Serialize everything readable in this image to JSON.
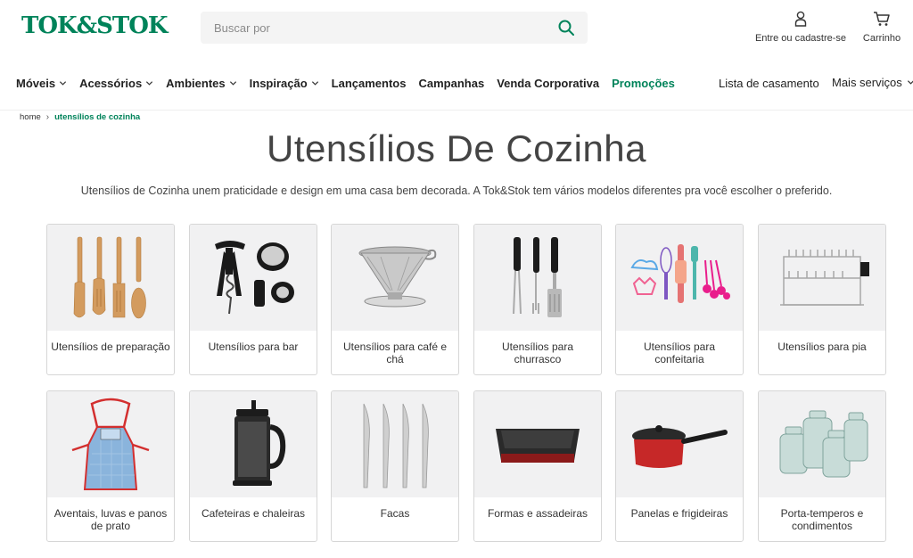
{
  "brand": {
    "logo_text": "TOK&STOK",
    "accent": "#00835a"
  },
  "search": {
    "placeholder": "Buscar por"
  },
  "account": {
    "label": "Entre ou cadastre-se"
  },
  "cart": {
    "label": "Carrinho"
  },
  "nav": {
    "items": [
      {
        "label": "Móveis",
        "has_dropdown": true
      },
      {
        "label": "Acessórios",
        "has_dropdown": true
      },
      {
        "label": "Ambientes",
        "has_dropdown": true
      },
      {
        "label": "Inspiração",
        "has_dropdown": true
      },
      {
        "label": "Lançamentos",
        "has_dropdown": false
      },
      {
        "label": "Campanhas",
        "has_dropdown": false
      },
      {
        "label": "Venda Corporativa",
        "has_dropdown": false
      },
      {
        "label": "Promoções",
        "has_dropdown": false,
        "highlight": "#00835a"
      }
    ],
    "right": {
      "wedding_list": "Lista de casamento",
      "more_services": "Mais serviços"
    }
  },
  "breadcrumb": {
    "home": "home",
    "current": "utensílios de cozinha"
  },
  "page": {
    "title": "Utensílios De Cozinha",
    "intro": "Utensílios de Cozinha unem praticidade e design em uma casa bem decorada. A Tok&Stok tem vários modelos diferentes pra você escolher o preferido."
  },
  "categories": [
    {
      "label": "Utensílios de preparação",
      "icon": "wooden-spoons-icon"
    },
    {
      "label": "Utensílios para bar",
      "icon": "corkscrew-icon"
    },
    {
      "label": "Utensílios para café e chá",
      "icon": "coffee-filter-icon"
    },
    {
      "label": "Utensílios para churrasco",
      "icon": "bbq-tools-icon"
    },
    {
      "label": "Utensílios para confeitaria",
      "icon": "baking-tools-icon"
    },
    {
      "label": "Utensílios para pia",
      "icon": "dish-rack-icon"
    },
    {
      "label": "Aventais, luvas e panos de prato",
      "icon": "apron-icon"
    },
    {
      "label": "Cafeteiras e chaleiras",
      "icon": "french-press-icon"
    },
    {
      "label": "Facas",
      "icon": "knives-icon"
    },
    {
      "label": "Formas e assadeiras",
      "icon": "baking-pan-icon"
    },
    {
      "label": "Panelas e frigideiras",
      "icon": "saucepan-icon"
    },
    {
      "label": "Porta-temperos e condimentos",
      "icon": "spice-jars-icon"
    }
  ]
}
